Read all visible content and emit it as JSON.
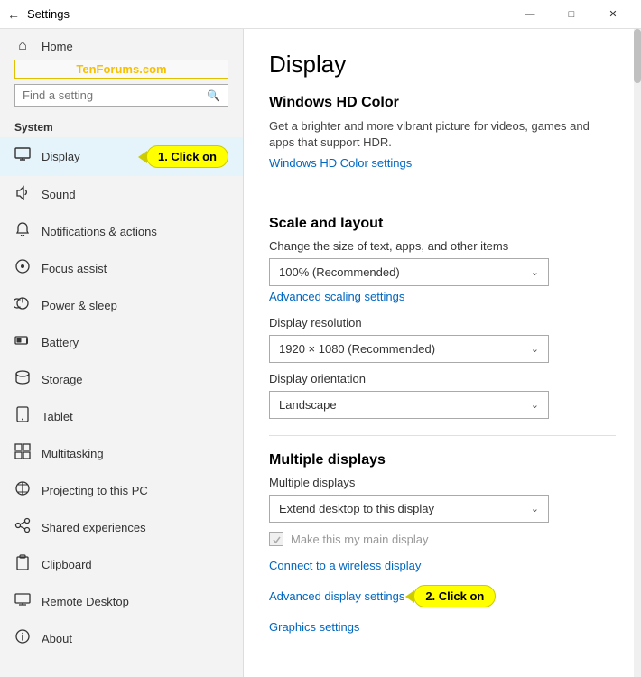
{
  "titleBar": {
    "title": "Settings",
    "minimize": "—",
    "maximize": "□",
    "close": "✕"
  },
  "watermark": "TenForums.com",
  "search": {
    "placeholder": "Find a setting",
    "icon": "🔍"
  },
  "sidebar": {
    "back_icon": "←",
    "section_label": "System",
    "items": [
      {
        "id": "home",
        "icon": "⌂",
        "label": "Home"
      },
      {
        "id": "display",
        "icon": "□",
        "label": "Display",
        "active": true
      },
      {
        "id": "sound",
        "icon": "🔊",
        "label": "Sound"
      },
      {
        "id": "notifications",
        "icon": "🔔",
        "label": "Notifications & actions"
      },
      {
        "id": "focus",
        "icon": "◎",
        "label": "Focus assist"
      },
      {
        "id": "power",
        "icon": "⏻",
        "label": "Power & sleep"
      },
      {
        "id": "battery",
        "icon": "🔋",
        "label": "Battery"
      },
      {
        "id": "storage",
        "icon": "💾",
        "label": "Storage"
      },
      {
        "id": "tablet",
        "icon": "📱",
        "label": "Tablet"
      },
      {
        "id": "multitasking",
        "icon": "⧉",
        "label": "Multitasking"
      },
      {
        "id": "projecting",
        "icon": "⊕",
        "label": "Projecting to this PC"
      },
      {
        "id": "shared",
        "icon": "∞",
        "label": "Shared experiences"
      },
      {
        "id": "clipboard",
        "icon": "📋",
        "label": "Clipboard"
      },
      {
        "id": "remote",
        "icon": "🖥",
        "label": "Remote Desktop"
      },
      {
        "id": "about",
        "icon": "ℹ",
        "label": "About"
      }
    ]
  },
  "callout1": "1. Click on",
  "callout2": "2. Click on",
  "content": {
    "page_title": "Display",
    "sections": {
      "hd_color": {
        "heading": "Windows HD Color",
        "desc": "Get a brighter and more vibrant picture for videos, games and apps that support HDR.",
        "link": "Windows HD Color settings"
      },
      "scale_layout": {
        "heading": "Scale and layout",
        "change_size_label": "Change the size of text, apps, and other items",
        "scale_value": "100% (Recommended)",
        "advanced_link": "Advanced scaling settings",
        "resolution_label": "Display resolution",
        "resolution_value": "1920 × 1080 (Recommended)",
        "orientation_label": "Display orientation",
        "orientation_value": "Landscape"
      },
      "multiple_displays": {
        "heading": "Multiple displays",
        "label": "Multiple displays",
        "dropdown_value": "Extend desktop to this display",
        "checkbox_label": "Make this my main display",
        "connect_link": "Connect to a wireless display",
        "advanced_display_link": "Advanced display settings",
        "graphics_link": "Graphics settings"
      }
    }
  }
}
